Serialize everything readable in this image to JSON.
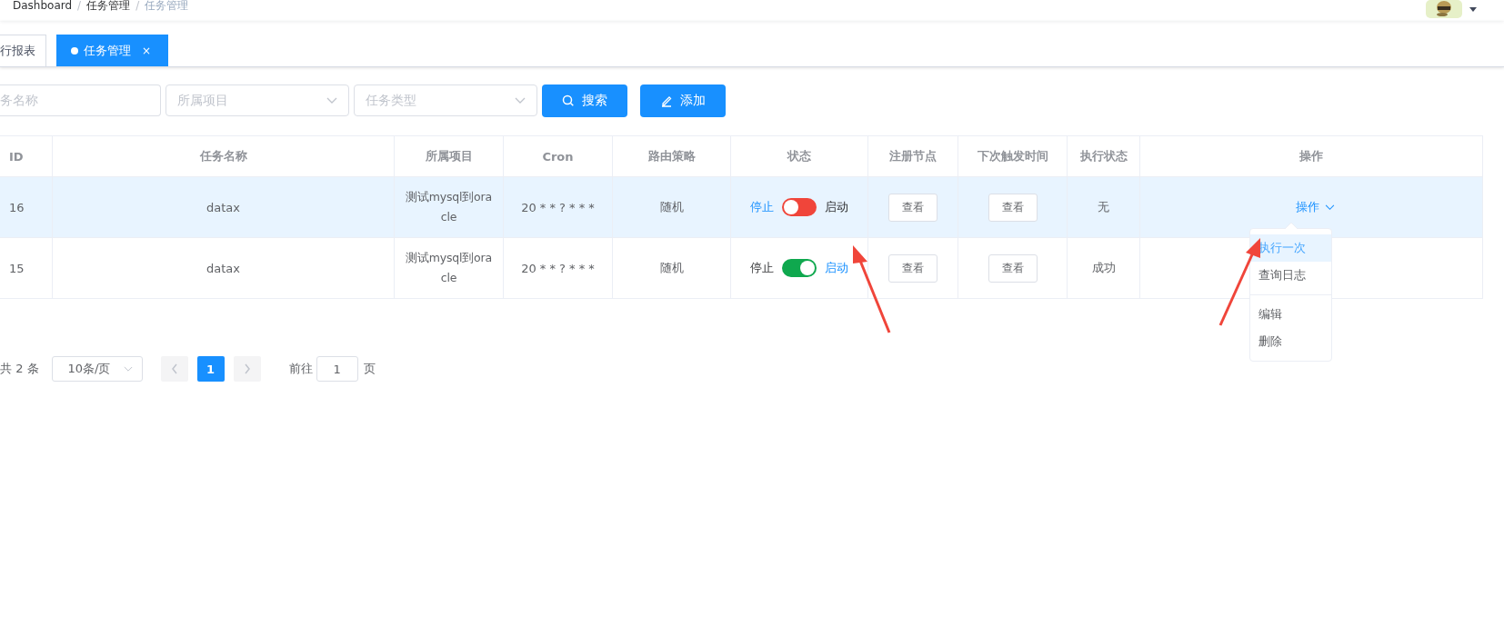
{
  "breadcrumb": {
    "separator": "/",
    "items": [
      "Dashboard",
      "任务管理",
      "任务管理"
    ]
  },
  "tabs": [
    {
      "label": "行报表",
      "selected": false
    },
    {
      "label": "任务管理",
      "selected": true,
      "close": "×"
    }
  ],
  "filters": [
    {
      "kind": "input",
      "placeholder": "务名称"
    },
    {
      "kind": "select",
      "placeholder": "所属项目"
    },
    {
      "kind": "select",
      "placeholder": "任务类型"
    }
  ],
  "buttons": [
    {
      "label": "搜索",
      "kind": "search"
    },
    {
      "label": "添加",
      "kind": "add"
    }
  ],
  "table": {
    "columns": [
      "ID",
      "任务名称",
      "所属项目",
      "Cron",
      "路由策略",
      "状态",
      "注册节点",
      "下次触发时间",
      "执行状态",
      "操作"
    ],
    "rows": [
      {
        "id": "16",
        "name": "datax",
        "project": "测试mysql到oracle",
        "cron": "20 * * ? * * *",
        "route": "随机",
        "status": {
          "off_label": "停止",
          "on_label": "启动",
          "on": false
        },
        "node": "查看",
        "next": "查看",
        "exec": "无",
        "action": "操作",
        "highlighted": true
      },
      {
        "id": "15",
        "name": "datax",
        "project": "测试mysql到oracle",
        "cron": "20 * * ? * * *",
        "route": "随机",
        "status": {
          "off_label": "停止",
          "on_label": "启动",
          "on": true
        },
        "node": "查看",
        "next": "查看",
        "exec": "成功",
        "highlighted": false
      }
    ]
  },
  "dropdown": [
    {
      "label": "执行一次",
      "selected": true,
      "divided": false
    },
    {
      "label": "查询日志",
      "selected": false,
      "divided": false
    },
    {
      "label": "编辑",
      "selected": false,
      "divided": true
    },
    {
      "label": "删除",
      "selected": false,
      "divided": false
    }
  ],
  "pagination": {
    "total": "共 2 条",
    "page_size": "10条/页",
    "pages": [
      {
        "label": "1",
        "selected": true
      }
    ],
    "goto_label": "前往",
    "goto_value": "1",
    "goto_suffix": "页"
  }
}
